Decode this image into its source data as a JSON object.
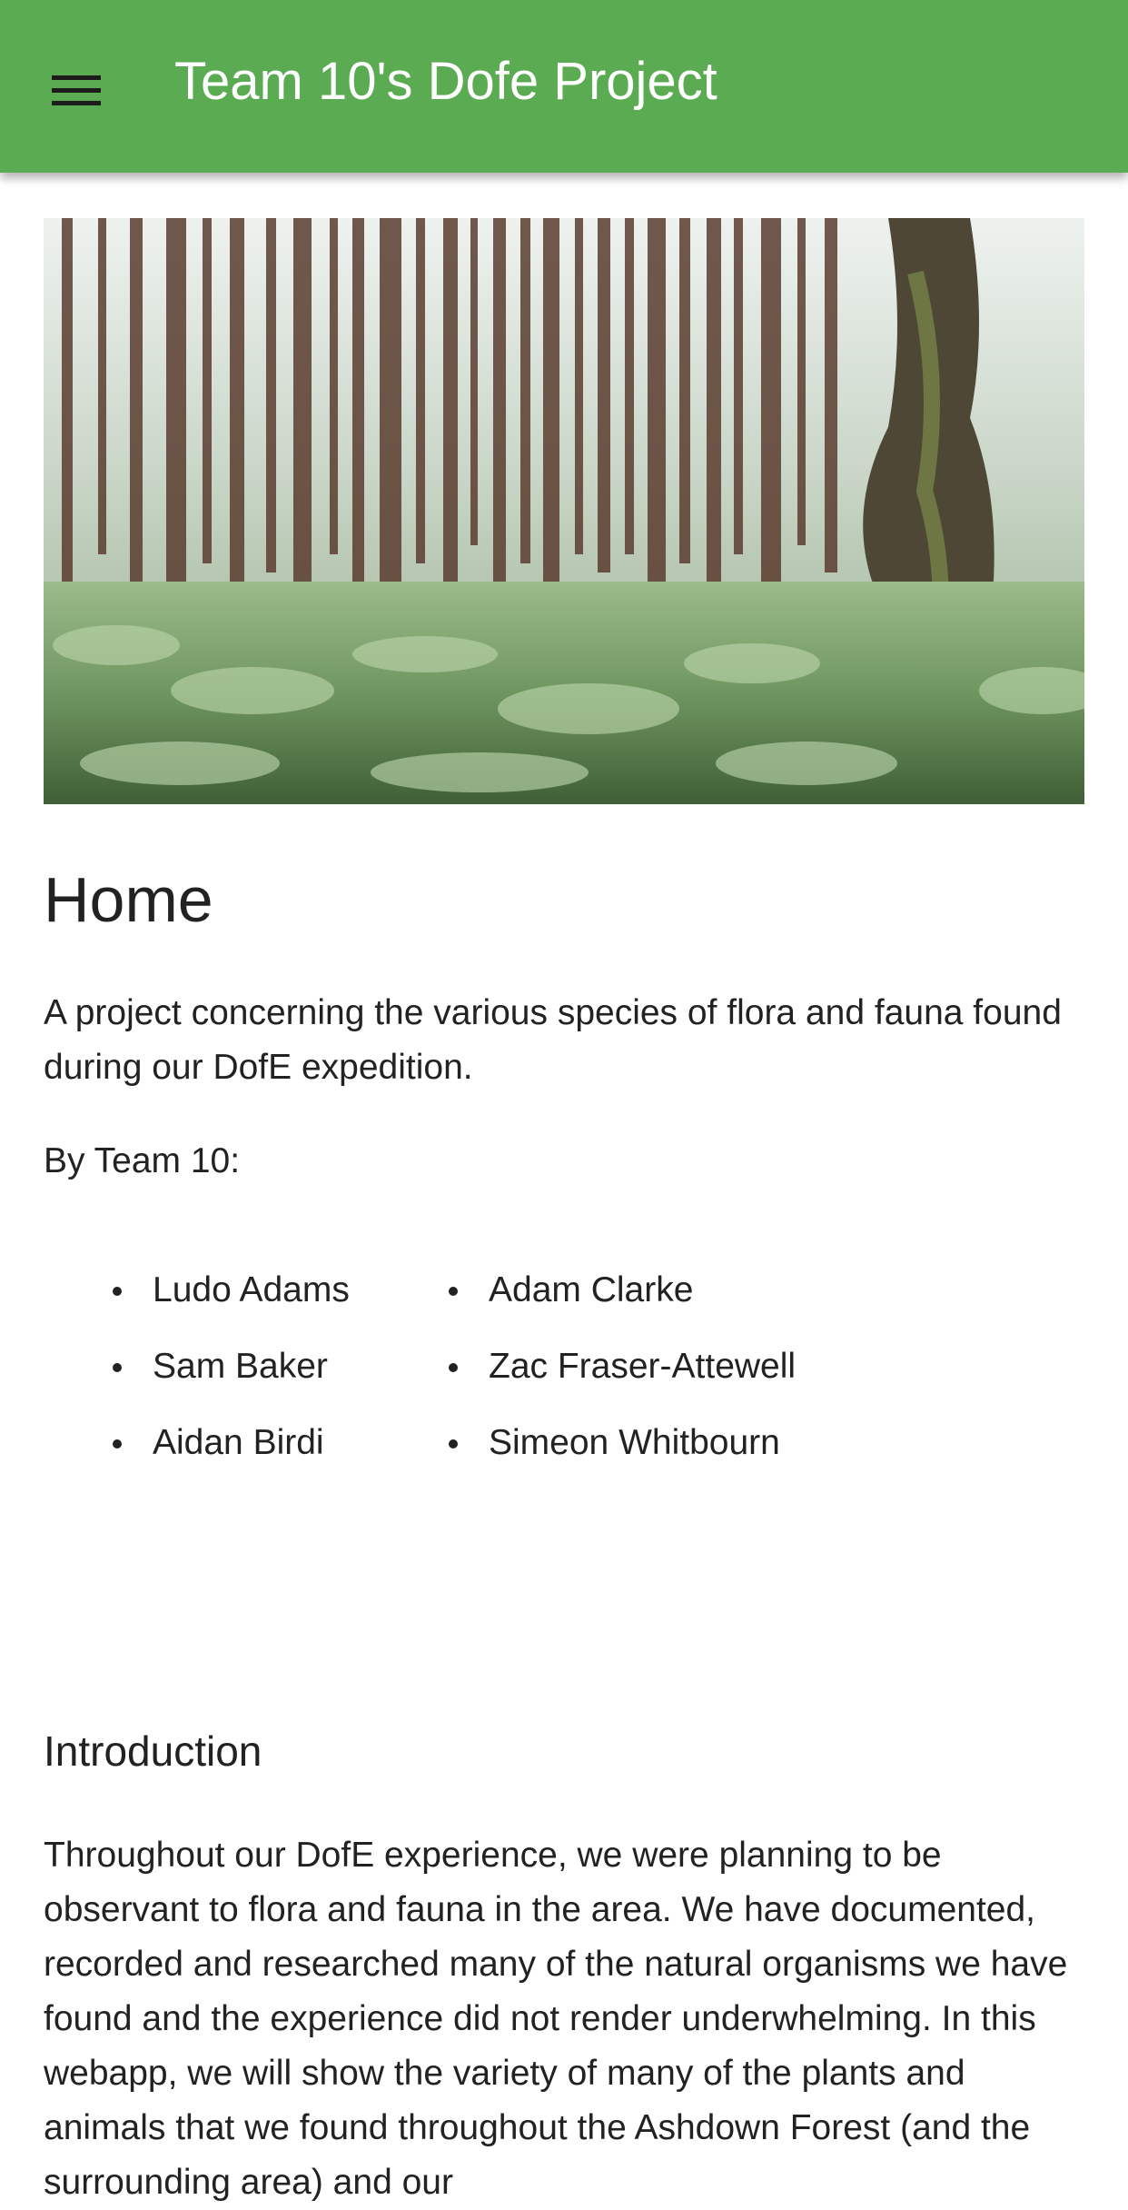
{
  "appbar": {
    "title": "Team 10's Dofe Project",
    "menu_icon": "hamburger-menu-icon",
    "color": "#5aab52"
  },
  "hero": {
    "image": "forest-image"
  },
  "page": {
    "title": "Home",
    "description": "A project concerning the various species of flora and fauna found during our DofE expedition.",
    "by_team": "By Team 10:",
    "members_col1": [
      "Ludo Adams",
      "Sam Baker",
      "Aidan Birdi"
    ],
    "members_col2": [
      "Adam Clarke",
      "Zac Fraser-Attewell",
      "Simeon Whitbourn"
    ],
    "intro_heading": "Introduction",
    "intro_text": "Throughout our DofE experience, we were planning to be observant to flora and fauna in the area. We have documented, recorded and researched many of the natural organisms we have found and the experience did not render underwhelming. In this webapp, we will show the variety of many of the plants and animals that we found throughout the Ashdown Forest (and the surrounding area) and our"
  }
}
